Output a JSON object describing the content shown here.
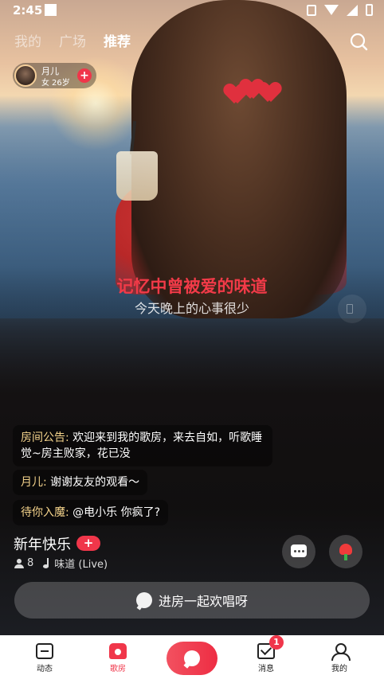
{
  "status_bar": {
    "time": "2:45"
  },
  "top_tabs": [
    {
      "label": "我的",
      "active": false
    },
    {
      "label": "广场",
      "active": false
    },
    {
      "label": "推荐",
      "active": true
    }
  ],
  "host": {
    "name": "月儿",
    "gender": "女",
    "age": "26岁",
    "follow": "+"
  },
  "lyrics": {
    "current": "记忆中曾被爱的味道",
    "next": "今天晚上的心事很少"
  },
  "chat": [
    {
      "user": "房间公告:",
      "text": "欢迎来到我的歌房，来去自如，听歌睡觉~房主败家，花已没"
    },
    {
      "user": "月儿:",
      "text": "谢谢友友的观看～"
    },
    {
      "user": "待你入魔:",
      "text": "@电小乐 你疯了?"
    }
  ],
  "room": {
    "title": "新年快乐",
    "follow": "+",
    "listeners": "8",
    "song": "味道 (Live)"
  },
  "join_button": "进房一起欢唱呀",
  "bottom_nav": [
    {
      "label": "动态",
      "icon": "dynamic-icon"
    },
    {
      "label": "歌房",
      "icon": "room-icon",
      "active": true
    },
    {
      "label": "",
      "icon": "mic-icon"
    },
    {
      "label": "消息",
      "icon": "message-icon",
      "badge": "1"
    },
    {
      "label": "我的",
      "icon": "profile-icon"
    }
  ],
  "colors": {
    "accent": "#f0364a",
    "lyric": "#f23a48",
    "chat_user": "#f5d48c"
  }
}
